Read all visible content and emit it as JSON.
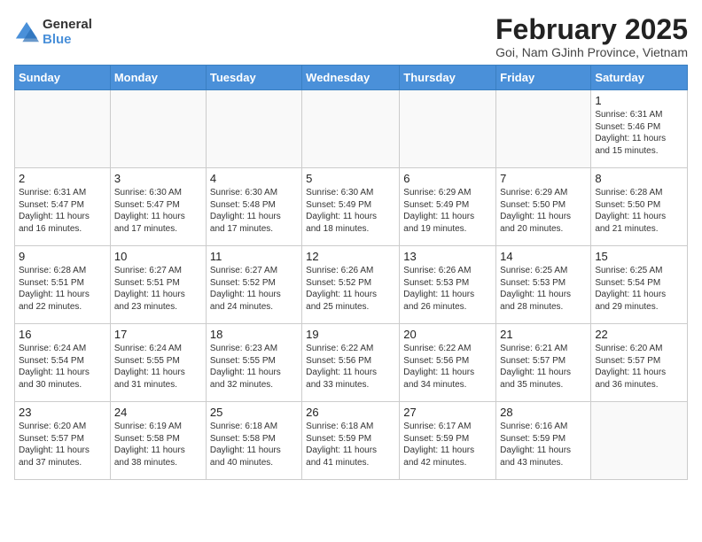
{
  "logo": {
    "general": "General",
    "blue": "Blue"
  },
  "title": "February 2025",
  "subtitle": "Goi, Nam GJinh Province, Vietnam",
  "headers": [
    "Sunday",
    "Monday",
    "Tuesday",
    "Wednesday",
    "Thursday",
    "Friday",
    "Saturday"
  ],
  "weeks": [
    [
      {
        "day": "",
        "info": ""
      },
      {
        "day": "",
        "info": ""
      },
      {
        "day": "",
        "info": ""
      },
      {
        "day": "",
        "info": ""
      },
      {
        "day": "",
        "info": ""
      },
      {
        "day": "",
        "info": ""
      },
      {
        "day": "1",
        "info": "Sunrise: 6:31 AM\nSunset: 5:46 PM\nDaylight: 11 hours\nand 15 minutes."
      }
    ],
    [
      {
        "day": "2",
        "info": "Sunrise: 6:31 AM\nSunset: 5:47 PM\nDaylight: 11 hours\nand 16 minutes."
      },
      {
        "day": "3",
        "info": "Sunrise: 6:30 AM\nSunset: 5:47 PM\nDaylight: 11 hours\nand 17 minutes."
      },
      {
        "day": "4",
        "info": "Sunrise: 6:30 AM\nSunset: 5:48 PM\nDaylight: 11 hours\nand 17 minutes."
      },
      {
        "day": "5",
        "info": "Sunrise: 6:30 AM\nSunset: 5:49 PM\nDaylight: 11 hours\nand 18 minutes."
      },
      {
        "day": "6",
        "info": "Sunrise: 6:29 AM\nSunset: 5:49 PM\nDaylight: 11 hours\nand 19 minutes."
      },
      {
        "day": "7",
        "info": "Sunrise: 6:29 AM\nSunset: 5:50 PM\nDaylight: 11 hours\nand 20 minutes."
      },
      {
        "day": "8",
        "info": "Sunrise: 6:28 AM\nSunset: 5:50 PM\nDaylight: 11 hours\nand 21 minutes."
      }
    ],
    [
      {
        "day": "9",
        "info": "Sunrise: 6:28 AM\nSunset: 5:51 PM\nDaylight: 11 hours\nand 22 minutes."
      },
      {
        "day": "10",
        "info": "Sunrise: 6:27 AM\nSunset: 5:51 PM\nDaylight: 11 hours\nand 23 minutes."
      },
      {
        "day": "11",
        "info": "Sunrise: 6:27 AM\nSunset: 5:52 PM\nDaylight: 11 hours\nand 24 minutes."
      },
      {
        "day": "12",
        "info": "Sunrise: 6:26 AM\nSunset: 5:52 PM\nDaylight: 11 hours\nand 25 minutes."
      },
      {
        "day": "13",
        "info": "Sunrise: 6:26 AM\nSunset: 5:53 PM\nDaylight: 11 hours\nand 26 minutes."
      },
      {
        "day": "14",
        "info": "Sunrise: 6:25 AM\nSunset: 5:53 PM\nDaylight: 11 hours\nand 28 minutes."
      },
      {
        "day": "15",
        "info": "Sunrise: 6:25 AM\nSunset: 5:54 PM\nDaylight: 11 hours\nand 29 minutes."
      }
    ],
    [
      {
        "day": "16",
        "info": "Sunrise: 6:24 AM\nSunset: 5:54 PM\nDaylight: 11 hours\nand 30 minutes."
      },
      {
        "day": "17",
        "info": "Sunrise: 6:24 AM\nSunset: 5:55 PM\nDaylight: 11 hours\nand 31 minutes."
      },
      {
        "day": "18",
        "info": "Sunrise: 6:23 AM\nSunset: 5:55 PM\nDaylight: 11 hours\nand 32 minutes."
      },
      {
        "day": "19",
        "info": "Sunrise: 6:22 AM\nSunset: 5:56 PM\nDaylight: 11 hours\nand 33 minutes."
      },
      {
        "day": "20",
        "info": "Sunrise: 6:22 AM\nSunset: 5:56 PM\nDaylight: 11 hours\nand 34 minutes."
      },
      {
        "day": "21",
        "info": "Sunrise: 6:21 AM\nSunset: 5:57 PM\nDaylight: 11 hours\nand 35 minutes."
      },
      {
        "day": "22",
        "info": "Sunrise: 6:20 AM\nSunset: 5:57 PM\nDaylight: 11 hours\nand 36 minutes."
      }
    ],
    [
      {
        "day": "23",
        "info": "Sunrise: 6:20 AM\nSunset: 5:57 PM\nDaylight: 11 hours\nand 37 minutes."
      },
      {
        "day": "24",
        "info": "Sunrise: 6:19 AM\nSunset: 5:58 PM\nDaylight: 11 hours\nand 38 minutes."
      },
      {
        "day": "25",
        "info": "Sunrise: 6:18 AM\nSunset: 5:58 PM\nDaylight: 11 hours\nand 40 minutes."
      },
      {
        "day": "26",
        "info": "Sunrise: 6:18 AM\nSunset: 5:59 PM\nDaylight: 11 hours\nand 41 minutes."
      },
      {
        "day": "27",
        "info": "Sunrise: 6:17 AM\nSunset: 5:59 PM\nDaylight: 11 hours\nand 42 minutes."
      },
      {
        "day": "28",
        "info": "Sunrise: 6:16 AM\nSunset: 5:59 PM\nDaylight: 11 hours\nand 43 minutes."
      },
      {
        "day": "",
        "info": ""
      }
    ]
  ]
}
